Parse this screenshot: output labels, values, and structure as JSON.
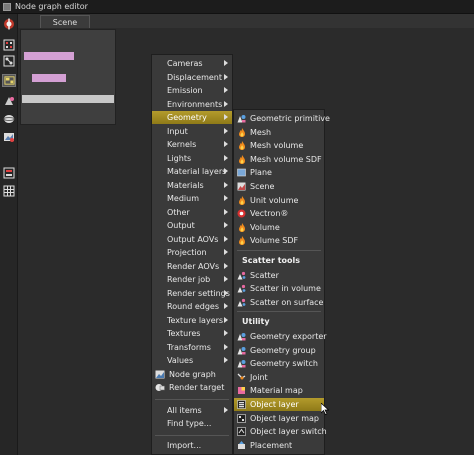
{
  "window": {
    "title": "Node graph editor"
  },
  "tabs": [
    {
      "label": "Scene"
    }
  ],
  "colors": {
    "highlight": "#a88e22",
    "node_pink": "#d4a0d4",
    "node_gray": "#c8c8c8",
    "menu_bg": "#3a3a3a"
  },
  "toolbar": {
    "icons": [
      "octane-logo-icon",
      "grid-icon",
      "nodes-icon",
      "layout-icon",
      "paint-icon",
      "sphere-icon",
      "film-icon",
      "stack-icon",
      "table-icon"
    ]
  },
  "main_menu": {
    "items": [
      {
        "label": "Cameras",
        "submenu": true
      },
      {
        "label": "Displacement",
        "submenu": true
      },
      {
        "label": "Emission",
        "submenu": true
      },
      {
        "label": "Environments",
        "submenu": true
      },
      {
        "label": "Geometry",
        "submenu": true,
        "highlighted": true
      },
      {
        "label": "Input",
        "submenu": true
      },
      {
        "label": "Kernels",
        "submenu": true
      },
      {
        "label": "Lights",
        "submenu": true
      },
      {
        "label": "Material layers",
        "submenu": true
      },
      {
        "label": "Materials",
        "submenu": true
      },
      {
        "label": "Medium",
        "submenu": true
      },
      {
        "label": "Other",
        "submenu": true
      },
      {
        "label": "Output",
        "submenu": true
      },
      {
        "label": "Output AOVs",
        "submenu": true
      },
      {
        "label": "Projection",
        "submenu": true
      },
      {
        "label": "Render AOVs",
        "submenu": true
      },
      {
        "label": "Render job",
        "submenu": true
      },
      {
        "label": "Render settings",
        "submenu": true
      },
      {
        "label": "Round edges",
        "submenu": true
      },
      {
        "label": "Texture layers",
        "submenu": true
      },
      {
        "label": "Textures",
        "submenu": true
      },
      {
        "label": "Transforms",
        "submenu": true
      },
      {
        "label": "Values",
        "submenu": true
      },
      {
        "label": "Node graph",
        "submenu": false,
        "icon": "node-graph-icon"
      },
      {
        "label": "Render target",
        "submenu": false,
        "icon": "render-target-icon"
      }
    ],
    "bottom_items": [
      {
        "label": "All items",
        "submenu": true
      },
      {
        "label": "Find type...",
        "submenu": false
      },
      {
        "label": "Import...",
        "submenu": false
      }
    ]
  },
  "geometry_menu": {
    "items": [
      {
        "label": "Geometric primitive",
        "icon": "primitive-icon"
      },
      {
        "label": "Mesh",
        "icon": "flame-icon"
      },
      {
        "label": "Mesh volume",
        "icon": "flame-icon"
      },
      {
        "label": "Mesh volume SDF",
        "icon": "flame-icon"
      },
      {
        "label": "Plane",
        "icon": "plane-icon"
      },
      {
        "label": "Scene",
        "icon": "scene-icon"
      },
      {
        "label": "Unit volume",
        "icon": "flame-icon"
      },
      {
        "label": "Vectron®",
        "icon": "vectron-icon"
      },
      {
        "label": "Volume",
        "icon": "flame-icon"
      },
      {
        "label": "Volume SDF",
        "icon": "flame-icon"
      }
    ],
    "scatter_heading": "Scatter tools",
    "scatter_items": [
      {
        "label": "Scatter",
        "icon": "scatter-icon"
      },
      {
        "label": "Scatter in volume",
        "icon": "scatter-icon"
      },
      {
        "label": "Scatter on surface",
        "icon": "scatter-icon"
      }
    ],
    "utility_heading": "Utility",
    "utility_items": [
      {
        "label": "Geometry exporter",
        "icon": "primitive-icon"
      },
      {
        "label": "Geometry group",
        "icon": "primitive-icon"
      },
      {
        "label": "Geometry switch",
        "icon": "primitive-icon"
      },
      {
        "label": "Joint",
        "icon": "joint-icon"
      },
      {
        "label": "Material map",
        "icon": "material-map-icon"
      },
      {
        "label": "Object layer",
        "icon": "object-layer-icon",
        "highlighted": true
      },
      {
        "label": "Object layer map",
        "icon": "object-layer-map-icon"
      },
      {
        "label": "Object layer switch",
        "icon": "object-layer-switch-icon"
      },
      {
        "label": "Placement",
        "icon": "placement-icon"
      }
    ]
  }
}
